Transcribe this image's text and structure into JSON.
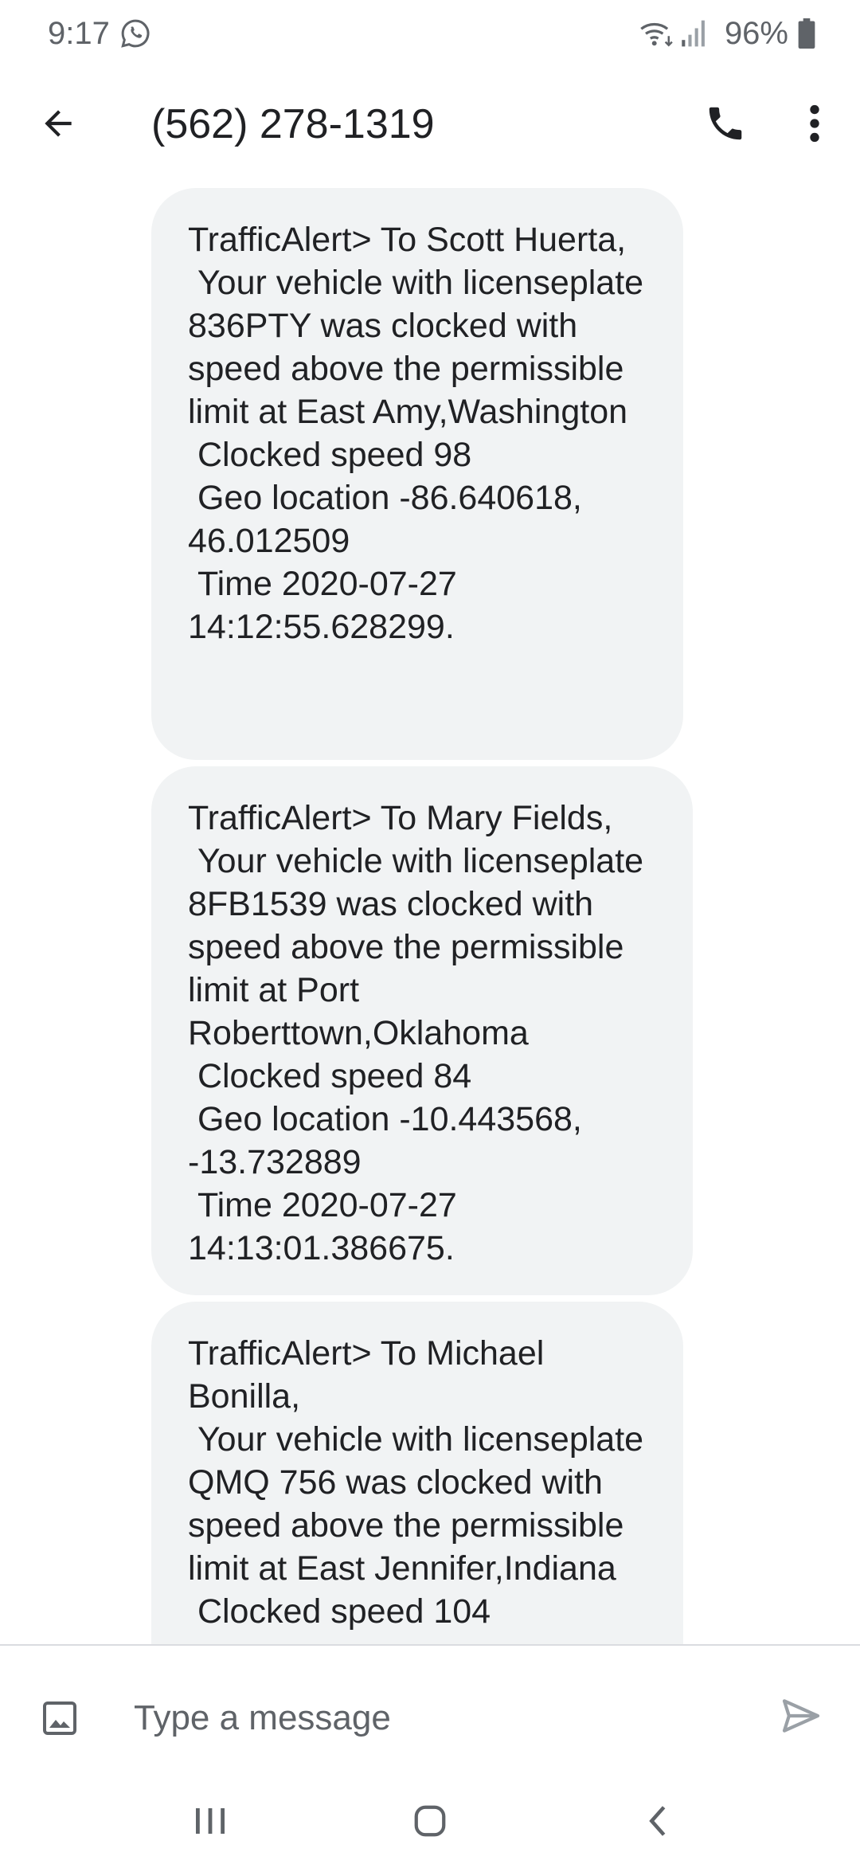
{
  "status_bar": {
    "time": "9:17",
    "battery_percent": "96%",
    "icons": [
      "whatsapp-icon",
      "wifi-icon",
      "signal-icon",
      "battery-icon"
    ]
  },
  "app_bar": {
    "title": "(562) 278-1319",
    "icons": [
      "back-arrow-icon",
      "phone-icon",
      "more-vert-icon"
    ]
  },
  "messages": [
    {
      "text": "TrafficAlert> To Scott Huerta,\n Your vehicle with licenseplate 836PTY was clocked with speed above the permissible limit at East Amy,Washington\n Clocked speed 98\n Geo location -86.640618, 46.012509\n Time 2020-07-27 14:12:55.628299."
    },
    {
      "text": "TrafficAlert> To Mary Fields,\n Your vehicle with licenseplate 8FB1539 was clocked with speed above the permissible limit at Port Roberttown,Oklahoma\n Clocked speed 84\n Geo location -10.443568, -13.732889\n Time 2020-07-27 14:13:01.386675."
    },
    {
      "text": "TrafficAlert> To Michael Bonilla,\n Your vehicle with licenseplate QMQ 756 was clocked with speed above the permissible limit at East Jennifer,Indiana\n Clocked speed 104"
    }
  ],
  "compose": {
    "placeholder": "Type a message",
    "value": ""
  },
  "nav_bar": {
    "icons": [
      "recents-icon",
      "home-icon",
      "nav-back-icon"
    ]
  },
  "colors": {
    "bubble_background": "#f1f3f4",
    "text_primary": "#202124",
    "icon_gray": "#5f6368"
  }
}
